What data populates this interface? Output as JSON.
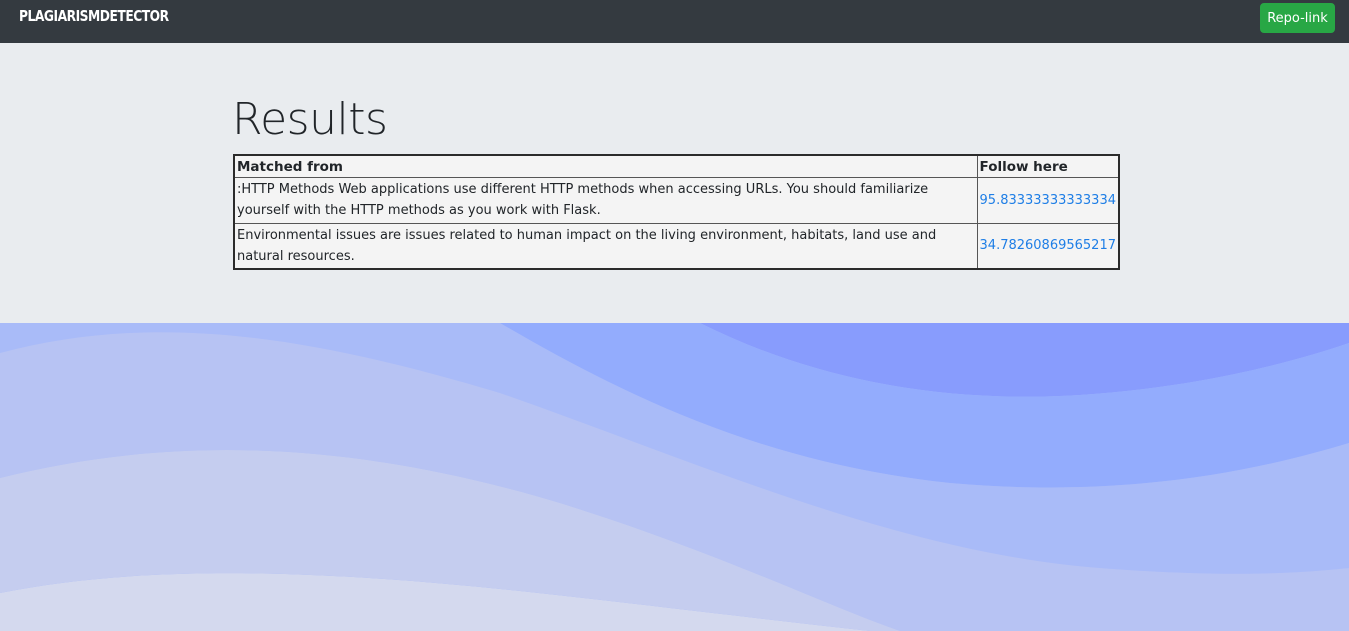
{
  "navbar": {
    "brand": "PLAGIARISMDETECTOR",
    "repo_button": "Repo-link"
  },
  "main": {
    "title": "Results",
    "table": {
      "headers": [
        "Matched from",
        "Follow here"
      ],
      "rows": [
        {
          "text": ":HTTP Methods Web applications use different HTTP methods when accessing URLs. You should familiarize yourself with the HTTP methods as you work with Flask.",
          "score": "95.83333333333334"
        },
        {
          "text": "Environmental issues are issues related to human impact on the living environment, habitats, land use and natural resources.",
          "score": "34.78260869565217"
        }
      ]
    }
  },
  "colors": {
    "navbar_bg": "#343a40",
    "button_green": "#28a745",
    "jumbotron_bg": "#e9ecef",
    "link_blue": "#1e7ee6"
  }
}
